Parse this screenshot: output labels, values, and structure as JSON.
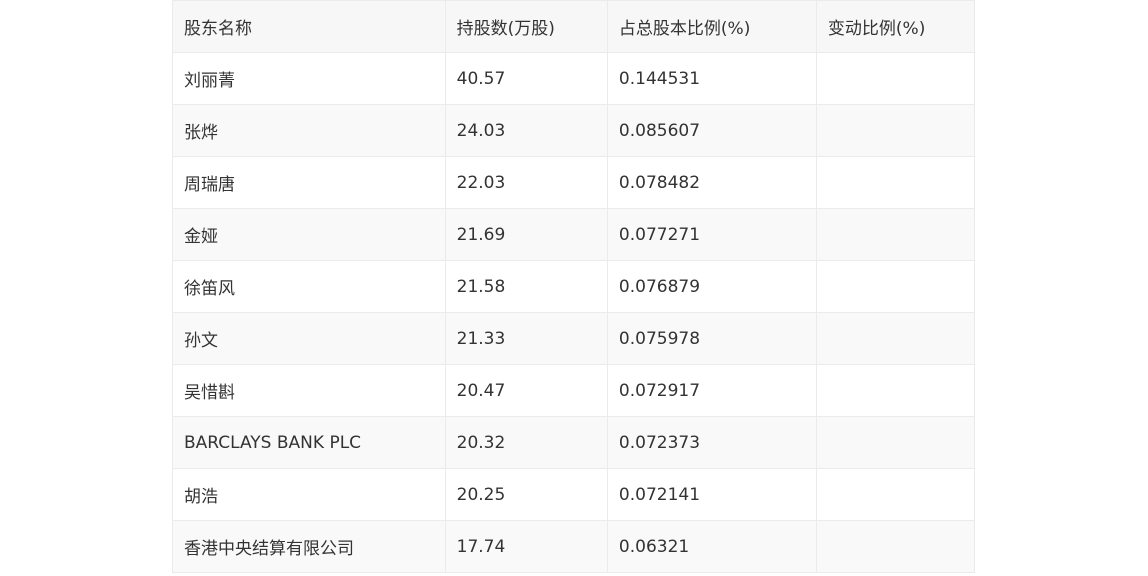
{
  "table": {
    "headers": {
      "name": "股东名称",
      "shares": "持股数(万股)",
      "ratio": "占总股本比例(%)",
      "change": "变动比例(%)"
    },
    "rows": [
      {
        "name": "刘丽菁",
        "shares": "40.57",
        "ratio": "0.144531",
        "change": ""
      },
      {
        "name": "张烨",
        "shares": "24.03",
        "ratio": "0.085607",
        "change": ""
      },
      {
        "name": "周瑞唐",
        "shares": "22.03",
        "ratio": "0.078482",
        "change": ""
      },
      {
        "name": "金娅",
        "shares": "21.69",
        "ratio": "0.077271",
        "change": ""
      },
      {
        "name": "徐笛风",
        "shares": "21.58",
        "ratio": "0.076879",
        "change": ""
      },
      {
        "name": "孙文",
        "shares": "21.33",
        "ratio": "0.075978",
        "change": ""
      },
      {
        "name": "吴惜斟",
        "shares": "20.47",
        "ratio": "0.072917",
        "change": ""
      },
      {
        "name": "BARCLAYS BANK PLC",
        "shares": "20.32",
        "ratio": "0.072373",
        "change": ""
      },
      {
        "name": "胡浩",
        "shares": "20.25",
        "ratio": "0.072141",
        "change": ""
      },
      {
        "name": "香港中央结算有限公司",
        "shares": "17.74",
        "ratio": "0.06321",
        "change": ""
      }
    ]
  },
  "colors": {
    "header_bg": "#f7f7f7",
    "stripe_bg": "#f9f9f9",
    "border": "#ebebeb",
    "text": "#333333"
  }
}
